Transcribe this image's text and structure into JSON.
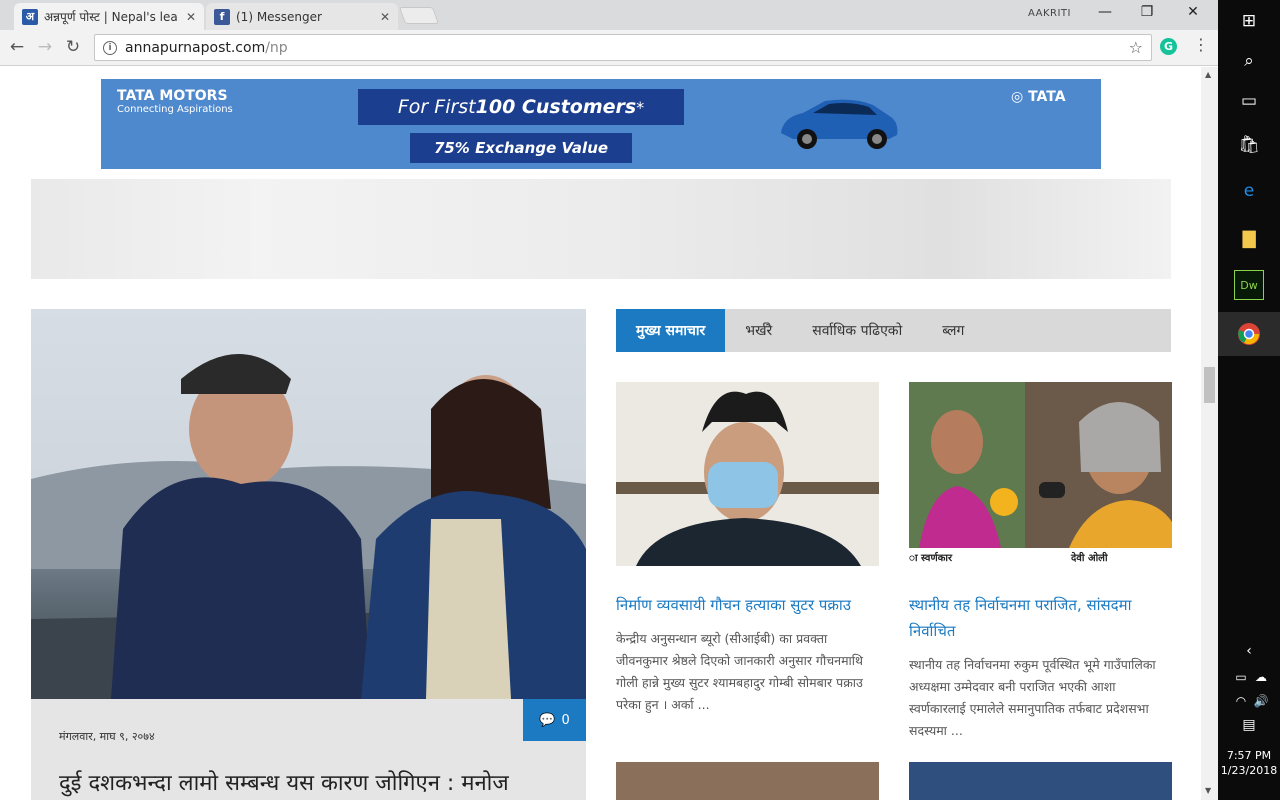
{
  "browser": {
    "tabs": [
      {
        "title": "अन्नपूर्ण पोस्ट | Nepal's lea",
        "favicon": "अ",
        "close": "✕"
      },
      {
        "title": "(1) Messenger",
        "favicon": "f",
        "close": "✕"
      }
    ],
    "profile": "AAKRITI",
    "url_domain": "annapurnapost.com",
    "url_path": "/np",
    "window_controls": {
      "minimize": "—",
      "maximize": "❐",
      "close": "✕"
    }
  },
  "ad": {
    "brand_line1": "TATA MOTORS",
    "brand_line2": "Connecting Aspirations",
    "headline_prefix": "For First ",
    "headline_strong": "100 Customers",
    "headline_mark": "*",
    "offer": "75% Exchange Value",
    "logo": "TATA"
  },
  "featured": {
    "comments": "0",
    "date": "मंगलवार, माघ ९, २०७४",
    "headline": "दुई दशकभन्दा लामो सम्बन्ध यस कारण जोगिएन : मनोज"
  },
  "news_tabs": [
    "मुख्य समाचार",
    "भर्खरै",
    "सर्वाधिक पढिएको",
    "ब्लग"
  ],
  "articles": [
    {
      "title": "निर्माण व्यवसायी गौचन हत्याका सुटर पक्राउ",
      "desc": "केन्द्रीय अनुसन्धान ब्यूरो (सीआईबी) का प्रवक्ता जीवनकुमार श्रेष्ठले दिएको जानकारी अनुसार गौचनमाथि गोली हान्ने मुख्य सुटर श्यामबहादुर गोम्बी सोमबार पक्राउ परेका हुन । अर्का ..."
    },
    {
      "title": "स्थानीय तह निर्वाचनमा पराजित, सांसदमा निर्वाचित",
      "desc": "स्थानीय तह निर्वाचनमा रुकुम पूर्वस्थित भूमे गाउँपालिका अध्यक्षमा उम्मेदवार बनी पराजित भएकी आशा स्वर्णकारलाई एमालेले समानुपातिक तर्फबाट प्रदेशसभा सदस्यमा ...",
      "caption_left": "ा स्वर्णकार",
      "caption_right": "देवी ओली"
    }
  ],
  "taskbar": {
    "time": "7:57 PM",
    "date": "1/23/2018"
  },
  "colors": {
    "accent": "#1b7ac2",
    "ad_bg": "#4f89cd"
  }
}
